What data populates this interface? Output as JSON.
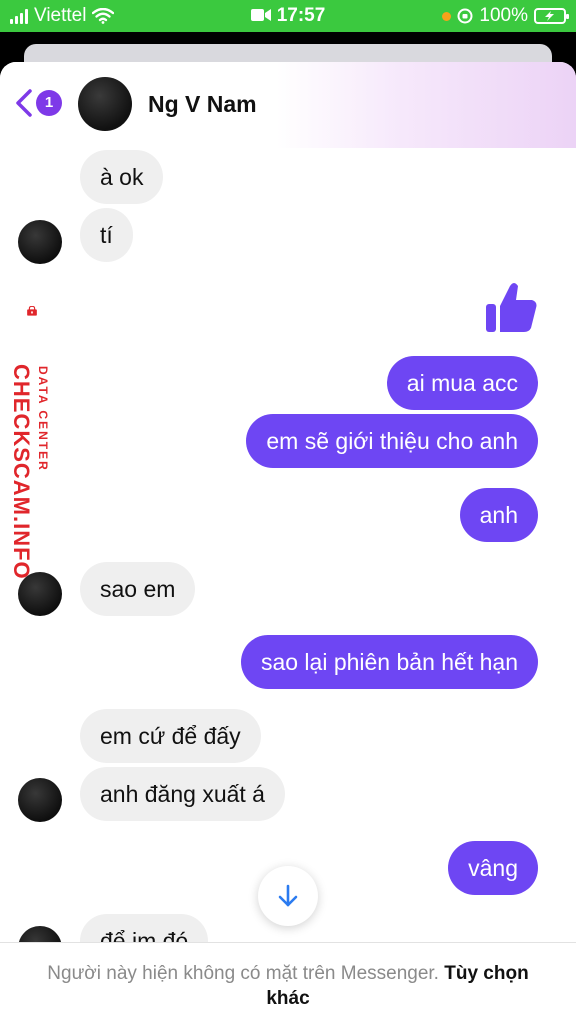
{
  "status": {
    "carrier": "Viettel",
    "time": "17:57",
    "battery": "100%"
  },
  "header": {
    "back_count": "1",
    "contact_name": "Ng V Nam"
  },
  "messages": [
    {
      "dir": "in",
      "text": "à ok"
    },
    {
      "dir": "in",
      "text": "tí"
    },
    {
      "dir": "out",
      "text": "ai mua acc"
    },
    {
      "dir": "out",
      "text": "em sẽ giới thiệu cho anh"
    },
    {
      "dir": "out",
      "text": "anh"
    },
    {
      "dir": "in",
      "text": "sao em"
    },
    {
      "dir": "out",
      "text": "sao lại phiên bản hết hạn"
    },
    {
      "dir": "in",
      "text": "em cứ để đấy"
    },
    {
      "dir": "in",
      "text": "anh đăng xuất á"
    },
    {
      "dir": "out",
      "text": "vâng"
    },
    {
      "dir": "in",
      "text": "để im đó"
    }
  ],
  "footer": {
    "note": "Người này hiện không có mặt trên Messenger.",
    "link": "Tùy chọn khác"
  },
  "watermark": {
    "small": "DATA CENTER",
    "main": "CHECKSCAM.INFO"
  },
  "colors": {
    "outgoing": "#6e46f3",
    "incoming": "#efefef",
    "status_bar": "#3bc93f",
    "watermark": "#e0262b"
  },
  "icons": [
    "wifi-icon",
    "camera-icon",
    "battery-icon",
    "back-chevron-icon",
    "thumbs-up-icon",
    "arrow-down-icon",
    "lock-icon"
  ]
}
